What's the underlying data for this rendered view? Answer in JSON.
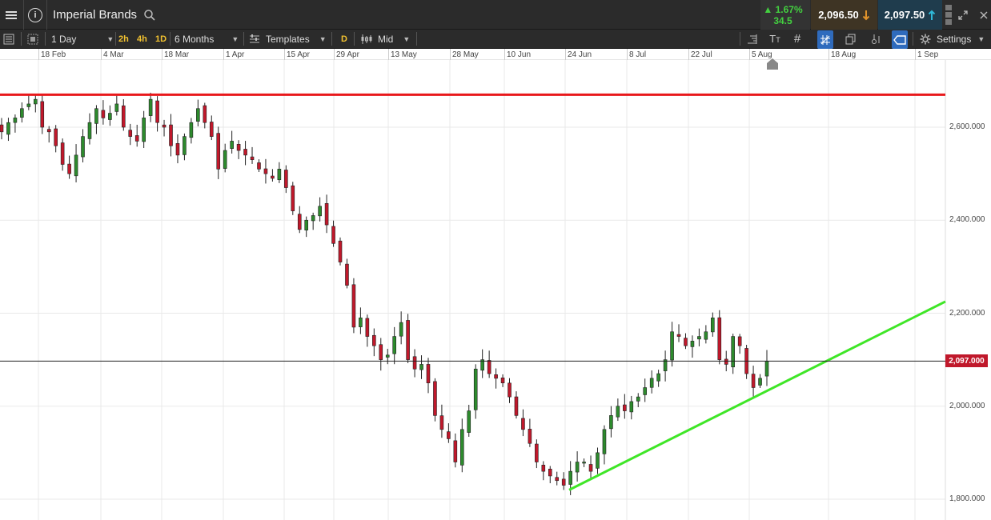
{
  "header": {
    "instrument": "Imperial Brands",
    "info_glyph": "i",
    "change_pct": "▲ 1.67%",
    "change_abs": "34.5",
    "sell_price": "2,096.50",
    "buy_price": "2,097.50"
  },
  "toolbar": {
    "interval": "1 Day",
    "quick_intervals": [
      "2h",
      "4h",
      "1D"
    ],
    "range": "6 Months",
    "templates": "Templates",
    "d_badge": "D",
    "price_mode": "Mid",
    "settings": "Settings"
  },
  "colors": {
    "resistance_line": "#e8181b",
    "trend_line": "#3fe627",
    "bull_candle": "#2d8a2d",
    "bear_candle": "#c0182b",
    "last_price": "#c0182b"
  },
  "chart_data": {
    "type": "candlestick",
    "x_labels": [
      "18 Feb",
      "4 Mar",
      "18 Mar",
      "1 Apr",
      "15 Apr",
      "29 Apr",
      "13 May",
      "28 May",
      "10 Jun",
      "24 Jun",
      "8 Jul",
      "22 Jul",
      "5 Aug",
      "18 Aug",
      "1 Sep"
    ],
    "y_ticks": [
      "2,600.000",
      "2,400.000",
      "2,200.000",
      "2,000.000",
      "1,800.000"
    ],
    "y_tick_values": [
      2600,
      2400,
      2200,
      2000,
      1800
    ],
    "last_price": "2,097.000",
    "last_price_value": 2097,
    "resistance_level": 2670,
    "trend_line": {
      "from": {
        "date": "24 Jun",
        "price": 1820
      },
      "to": {
        "date": "4 Sep",
        "price": 2225
      }
    },
    "closes": [
      2590,
      2610,
      2620,
      2640,
      2650,
      2660,
      2600,
      2590,
      2560,
      2520,
      2500,
      2540,
      2580,
      2610,
      2640,
      2620,
      2630,
      2650,
      2600,
      2580,
      2570,
      2620,
      2660,
      2610,
      2600,
      2560,
      2540,
      2580,
      2610,
      2640,
      2610,
      2580,
      2510,
      2550,
      2570,
      2550,
      2540,
      2530,
      2510,
      2500,
      2490,
      2510,
      2470,
      2420,
      2380,
      2400,
      2410,
      2430,
      2390,
      2350,
      2310,
      2260,
      2170,
      2190,
      2150,
      2130,
      2100,
      2110,
      2150,
      2180,
      2100,
      2080,
      2090,
      2050,
      1980,
      1950,
      1930,
      1880,
      1950,
      1990,
      2080,
      2100,
      2070,
      2060,
      2050,
      2020,
      1980,
      1950,
      1920,
      1880,
      1860,
      1850,
      1840,
      1830,
      1860,
      1880,
      1880,
      1860,
      1900,
      1950,
      1980,
      2000,
      1990,
      2010,
      2020,
      2040,
      2060,
      2070,
      2100,
      2160,
      2150,
      2130,
      2140,
      2150,
      2160,
      2190,
      2100,
      2090,
      2150,
      2130,
      2070,
      2040,
      2060,
      2097
    ]
  }
}
